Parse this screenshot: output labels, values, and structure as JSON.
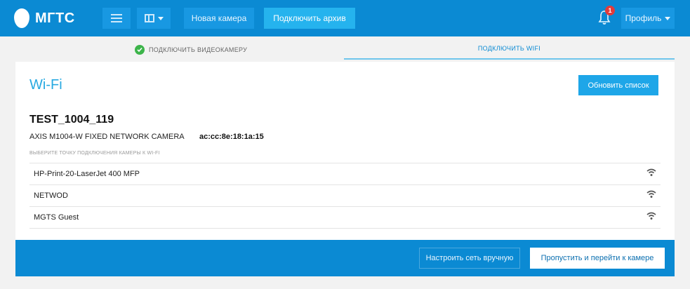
{
  "header": {
    "logo_text": "МГТС",
    "new_camera_label": "Новая камера",
    "connect_archive_label": "Подключить архив",
    "notification_count": "1",
    "profile_label": "Профиль"
  },
  "steps": {
    "step1_label": "ПОДКЛЮЧИТЬ ВИДЕОКАМЕРУ",
    "step2_label": "ПОДКЛЮЧИТЬ WIFI"
  },
  "wifi": {
    "title": "Wi-Fi",
    "refresh_label": "Обновить список",
    "camera_name": "TEST_1004_119",
    "camera_model": "AXIS M1004-W FIXED NETWORK CAMERA",
    "camera_mac": "ac:cc:8e:18:1a:15",
    "choose_label": "ВЫБЕРИТЕ ТОЧКУ ПОДКЛЮЧЕНИЯ КАМЕРЫ К WI-FI",
    "networks": [
      {
        "name": "HP-Print-20-LaserJet 400 MFP"
      },
      {
        "name": "NETWOD"
      },
      {
        "name": "MGTS Guest"
      }
    ]
  },
  "footer": {
    "manual_label": "Настроить сеть вручную",
    "skip_label": "Пропустить и перейти к камере"
  },
  "colors": {
    "brand_blue": "#0b8ad3",
    "accent_blue": "#1ea6e8",
    "success_green": "#3cb44a",
    "badge_red": "#e23b3b"
  }
}
